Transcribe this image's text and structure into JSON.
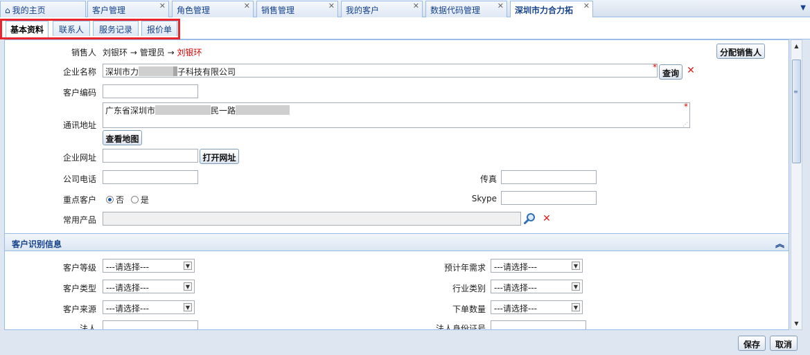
{
  "top_tabs": [
    {
      "label": "我的主页",
      "icon": "home-icon",
      "closable": false
    },
    {
      "label": "客户管理",
      "closable": true
    },
    {
      "label": "角色管理",
      "closable": true
    },
    {
      "label": "销售管理",
      "closable": true
    },
    {
      "label": "我的客户",
      "closable": true
    },
    {
      "label": "数据代码管理",
      "closable": true
    },
    {
      "label": "深圳市力合力拓",
      "closable": true,
      "active": true
    }
  ],
  "sub_tabs": [
    {
      "label": "基本资料",
      "active": true
    },
    {
      "label": "联系人"
    },
    {
      "label": "服务记录"
    },
    {
      "label": "报价单"
    }
  ],
  "highlight_color": "#e9252e",
  "form": {
    "salesperson": {
      "label": "销售人",
      "value": "刘银环",
      "arrow1": "→",
      "role": "管理员",
      "arrow2": "→",
      "assignee": "刘银环"
    },
    "assign_button": "分配销售人",
    "company_name": {
      "label": "企业名称",
      "value_prefix": "深圳市力",
      "value_suffix": "子科技有限公司",
      "required": "*"
    },
    "query_button": "查询",
    "customer_code": {
      "label": "客户编码",
      "value": ""
    },
    "address": {
      "label": "通讯地址",
      "value_prefix": "广东省深圳市",
      "value_mid": "民一路",
      "required": "*"
    },
    "map_button": "查看地图",
    "website": {
      "label": "企业网址",
      "value": ""
    },
    "open_url_button": "打开网址",
    "phone": {
      "label": "公司电话",
      "value": ""
    },
    "fax": {
      "label": "传真",
      "value": ""
    },
    "key_customer": {
      "label": "重点客户",
      "options": [
        "否",
        "是"
      ],
      "selected": "否"
    },
    "skype": {
      "label": "Skype",
      "value": ""
    },
    "products": {
      "label": "常用产品",
      "value": ""
    }
  },
  "section": {
    "title": "客户识别信息",
    "fields": {
      "level": {
        "label": "客户等级",
        "value": "---请选择---"
      },
      "type": {
        "label": "客户类型",
        "value": "---请选择---"
      },
      "source": {
        "label": "客户来源",
        "value": "---请选择---"
      },
      "legal_person": {
        "label": "法人",
        "value": ""
      },
      "annual_demand": {
        "label": "预计年需求",
        "value": "---请选择---"
      },
      "industry": {
        "label": "行业类别",
        "value": "---请选择---"
      },
      "order_qty": {
        "label": "下单数量",
        "value": "---请选择---"
      },
      "legal_id": {
        "label": "法人身份证号",
        "value": ""
      }
    }
  },
  "footer": {
    "save": "保存",
    "cancel": "取消"
  }
}
